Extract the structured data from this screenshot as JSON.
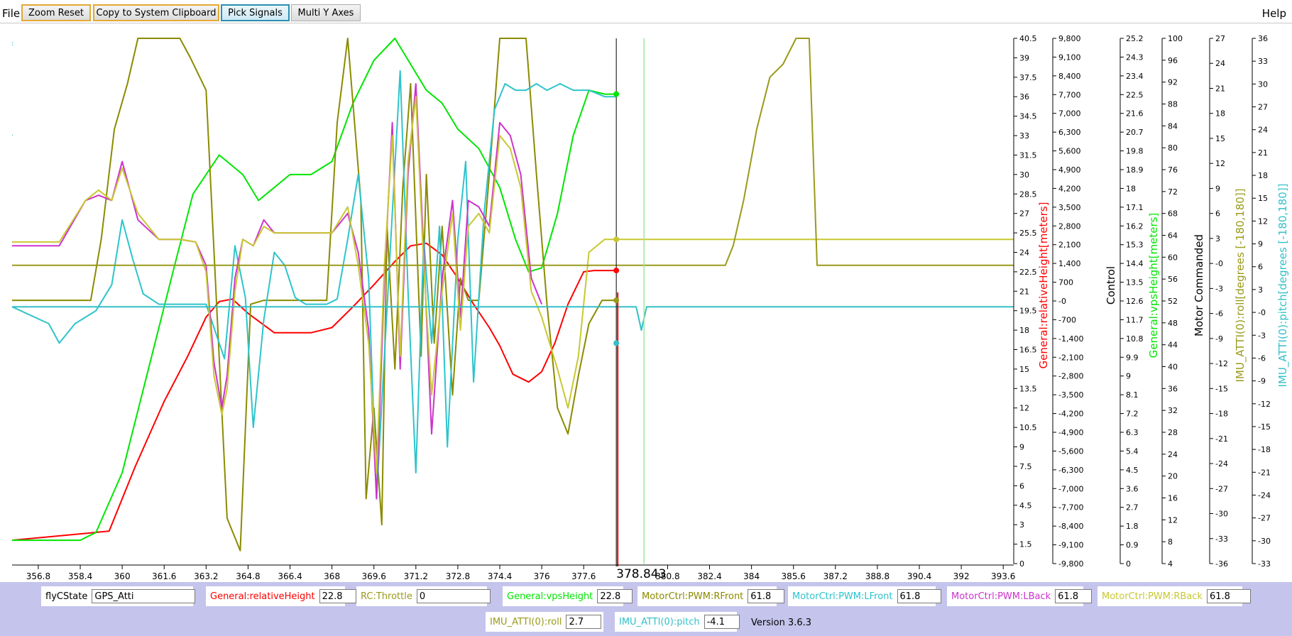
{
  "toolbar": {
    "file_label": "File",
    "zoom_reset_label": "Zoom Reset",
    "copy_clipboard_label": "Copy to System Clipboard",
    "pick_signals_label": "Pick Signals",
    "multi_y_label": "Multi Y Axes",
    "help_label": "Help"
  },
  "colors": {
    "relativeHeight": "#ff0000",
    "vpsHeight": "#00e600",
    "rfront": "#8b8b00",
    "lfront": "#2dc4cc",
    "lback": "#cc33cc",
    "rback": "#c8c832",
    "roll": "#9a9a1a",
    "pitch": "#33c0c8",
    "dark_olive": "#808000",
    "axis": "#000000",
    "panel_bg": "#c4c4ec"
  },
  "chart_data": {
    "type": "line",
    "cursor_label": "378.843",
    "x_ticks": [
      "356.8",
      "358.4",
      "360",
      "361.6",
      "363.2",
      "364.8",
      "366.4",
      "368",
      "369.6",
      "371.2",
      "372.8",
      "374.4",
      "376",
      "377.6",
      "380.8",
      "382.4",
      "384",
      "385.6",
      "387.2",
      "388.8",
      "390.4",
      "392",
      "393.6"
    ],
    "x_tick_values": [
      356.8,
      358.4,
      360,
      361.6,
      363.2,
      364.8,
      366.4,
      368,
      369.6,
      371.2,
      372.8,
      374.4,
      376,
      377.6,
      380.8,
      382.4,
      384,
      385.6,
      387.2,
      388.8,
      390.4,
      392,
      393.6
    ],
    "xlim": [
      355.8,
      394.0
    ],
    "cursor_x": 378.843,
    "x2_ref": 379.9,
    "axes": [
      {
        "id": "axis1",
        "label": "",
        "color": "#000000",
        "ticks": [
          "40.5",
          "39",
          "37.5",
          "36",
          "34.5",
          "33",
          "31.5",
          "30",
          "28.5",
          "27",
          "25.5",
          "24",
          "22.5",
          "21",
          "19.5",
          "18",
          "16.5",
          "15",
          "13.5",
          "12",
          "10.5",
          "9",
          "7.5",
          "6",
          "4.5",
          "3",
          "1.5",
          "0"
        ]
      },
      {
        "id": "relativeHeight",
        "label": "General:relativeHeight[meters]",
        "color": "#ff0000",
        "ticks": [
          "9,800",
          "9,100",
          "8,400",
          "7,700",
          "7,000",
          "6,300",
          "5,600",
          "4,900",
          "4,200",
          "3,500",
          "2,800",
          "2,100",
          "1,400",
          "700",
          "-0",
          "-700",
          "-1,400",
          "-2,100",
          "-2,800",
          "-3,500",
          "-4,200",
          "-4,900",
          "-5,600",
          "-6,300",
          "-7,000",
          "-7,700",
          "-8,400",
          "-9,100",
          "-9,800"
        ]
      },
      {
        "id": "control",
        "label": "Control",
        "color": "#000000",
        "ticks": [
          "25.2",
          "24.3",
          "23.4",
          "22.5",
          "21.6",
          "20.7",
          "19.8",
          "18.9",
          "18",
          "17.1",
          "16.2",
          "15.3",
          "14.4",
          "13.5",
          "12.6",
          "11.7",
          "10.8",
          "9.9",
          "9",
          "8.1",
          "7.2",
          "6.3",
          "5.4",
          "4.5",
          "3.6",
          "2.7",
          "1.8",
          "0.9",
          "0"
        ]
      },
      {
        "id": "vpsHeight",
        "label": "General:vpsHeight[meters]",
        "color": "#00e600",
        "ticks": [
          "100",
          "96",
          "92",
          "88",
          "84",
          "80",
          "76",
          "72",
          "68",
          "64",
          "60",
          "56",
          "52",
          "48",
          "44",
          "40",
          "36",
          "32",
          "28",
          "24",
          "20",
          "16",
          "12",
          "8",
          "4"
        ]
      },
      {
        "id": "motor",
        "label": "Motor Commanded",
        "color": "#000000",
        "ticks": [
          "27",
          "24",
          "21",
          "18",
          "15",
          "12",
          "9",
          "6",
          "3",
          "-0",
          "-3",
          "-6",
          "-9",
          "-12",
          "-15",
          "-18",
          "-21",
          "-24",
          "-27",
          "-30",
          "-33",
          "-36"
        ]
      },
      {
        "id": "roll",
        "label": "IMU_ATTI(0):roll[degrees [-180,180]]",
        "color": "#9a9a1a",
        "ticks": [
          "36",
          "33",
          "30",
          "27",
          "24",
          "21",
          "18",
          "15",
          "12",
          "9",
          "6",
          "3",
          "-0",
          "-3",
          "-6",
          "-9",
          "-12",
          "-15",
          "-18",
          "-21",
          "-24",
          "-27",
          "-30",
          "-33"
        ]
      },
      {
        "id": "pitch",
        "label": "IMU_ATTI(0):pitch[degrees [-180,180]]",
        "color": "#33c0c8",
        "ticks": []
      }
    ],
    "series": [
      {
        "name": "General:relativeHeight",
        "color": "#ff0000",
        "axis_range": [
          0,
          40.5
        ],
        "x": [
          355.8,
          359.5,
          360.5,
          361.6,
          362.5,
          363.2,
          363.7,
          364.2,
          364.8,
          365.8,
          366.4,
          367.2,
          368.0,
          368.8,
          369.6,
          370.4,
          371.0,
          371.6,
          372.2,
          372.8,
          373.4,
          374.0,
          374.4,
          374.9,
          375.5,
          376.0,
          376.5,
          377.0,
          377.6,
          378.0,
          378.843
        ],
        "y": [
          1.8,
          2.5,
          7.5,
          12.5,
          16.0,
          19.0,
          20.2,
          20.4,
          19.3,
          17.8,
          17.8,
          17.8,
          18.2,
          19.8,
          21.5,
          23.3,
          24.5,
          24.7,
          23.8,
          22.0,
          20.0,
          18.2,
          16.8,
          14.6,
          14.0,
          14.8,
          17.0,
          20.0,
          22.5,
          22.6,
          22.6
        ]
      },
      {
        "name": "General:vpsHeight",
        "color": "#00e600",
        "axis_range": [
          0,
          40.5
        ],
        "x": [
          355.8,
          358.4,
          359.0,
          360.0,
          361.0,
          362.0,
          362.7,
          363.7,
          364.6,
          365.2,
          365.8,
          366.4,
          367.2,
          368.0,
          368.8,
          369.6,
          370.4,
          371.0,
          371.6,
          372.2,
          372.8,
          373.6,
          374.4,
          375.0,
          375.5,
          376.0,
          376.6,
          377.2,
          377.8,
          378.4,
          378.843
        ],
        "y": [
          1.8,
          1.8,
          2.4,
          7.0,
          15.0,
          23.0,
          28.5,
          31.5,
          30.0,
          28.0,
          29.0,
          30.0,
          30.0,
          31.0,
          35.5,
          38.8,
          40.5,
          38.5,
          36.5,
          35.5,
          33.5,
          32.0,
          29.0,
          25.0,
          22.5,
          22.8,
          27.0,
          33.0,
          36.5,
          36.2,
          36.2
        ]
      },
      {
        "name": "MotorCtrl:PWM:RFront",
        "color": "#8b8b00",
        "axis_range": [
          0,
          40.5
        ],
        "x": [
          355.8,
          358.8,
          359.2,
          359.7,
          360.2,
          360.6,
          361.2,
          361.6,
          362.2,
          362.6,
          363.2,
          363.6,
          364.0,
          364.5,
          364.9,
          365.4,
          366.0,
          366.6,
          367.2,
          367.8,
          368.2,
          368.6,
          369.1,
          369.3,
          369.6,
          369.9,
          370.1,
          370.4,
          370.7,
          371.0,
          371.4,
          371.6,
          371.9,
          372.2,
          372.6,
          372.9,
          373.2,
          373.6,
          374.0,
          374.4,
          374.7,
          375.0,
          375.4,
          375.8,
          376.2,
          376.6,
          377.0,
          377.4,
          377.8,
          378.3,
          378.843
        ],
        "y": [
          20.3,
          20.3,
          25.0,
          33.5,
          37.0,
          40.5,
          40.5,
          40.5,
          40.5,
          39.0,
          36.5,
          20.0,
          3.5,
          1.0,
          20.0,
          20.3,
          20.3,
          20.3,
          20.3,
          20.3,
          34.0,
          40.5,
          28.0,
          5.0,
          12.0,
          3.0,
          26.0,
          15.0,
          29.0,
          37.0,
          16.0,
          30.0,
          17.0,
          26.0,
          13.0,
          22.0,
          20.3,
          20.3,
          30.0,
          40.5,
          40.5,
          40.5,
          40.5,
          30.0,
          20.0,
          12.0,
          10.0,
          14.5,
          18.5,
          20.3,
          20.3
        ]
      },
      {
        "name": "MotorCtrl:PWM:LFront",
        "color": "#2dc4cc",
        "axis_range": [
          0,
          40.5
        ],
        "x": [
          355.8,
          357.2,
          357.6,
          358.2,
          359.0,
          359.6,
          360.0,
          360.4,
          360.8,
          361.4,
          362.0,
          362.8,
          363.2,
          363.5,
          363.9,
          364.3,
          364.7,
          365.0,
          365.4,
          365.8,
          366.2,
          366.6,
          367.0,
          367.4,
          367.8,
          368.2,
          368.6,
          369.0,
          369.4,
          369.7,
          370.0,
          370.3,
          370.6,
          370.9,
          371.2,
          371.5,
          371.8,
          372.1,
          372.4,
          372.8,
          373.1,
          373.4,
          373.8,
          374.2,
          374.6,
          375.0,
          375.4,
          375.8,
          376.2,
          376.7,
          377.2,
          377.8,
          378.4,
          378.843
        ],
        "y": [
          19.8,
          18.5,
          17.0,
          18.5,
          19.5,
          21.5,
          26.5,
          23.5,
          20.8,
          20.0,
          20.0,
          20.0,
          20.0,
          18.2,
          15.8,
          24.5,
          20.5,
          10.5,
          18.8,
          24.0,
          23.0,
          20.5,
          20.0,
          20.0,
          20.0,
          20.4,
          25.0,
          30.0,
          22.0,
          5.0,
          16.0,
          27.0,
          38.0,
          21.0,
          7.0,
          25.0,
          17.0,
          26.0,
          9.0,
          25.0,
          31.0,
          14.0,
          27.0,
          35.0,
          37.0,
          36.5,
          36.5,
          37.0,
          36.5,
          37.0,
          36.5,
          36.5,
          36.0,
          36.0
        ]
      },
      {
        "name": "MotorCtrl:PWM:LBack",
        "color": "#cc33cc",
        "axis_range": [
          0,
          40.5
        ],
        "x": [
          355.8,
          357.6,
          358.6,
          359.1,
          359.6,
          360.0,
          360.6,
          361.4,
          362.2,
          362.8,
          363.2,
          363.5,
          363.8,
          364.0,
          364.3,
          364.6,
          365.0,
          365.4,
          365.8,
          366.2,
          366.8,
          367.4,
          368.0,
          368.6,
          369.0,
          369.4,
          369.7,
          370.0,
          370.3,
          370.6,
          370.9,
          371.2,
          371.5,
          371.8,
          372.2,
          372.6,
          372.9,
          373.2,
          373.6,
          374.0,
          374.4,
          374.8,
          375.2,
          375.6,
          376.0
        ],
        "y": [
          24.5,
          24.5,
          28.0,
          28.4,
          28.0,
          31.0,
          26.5,
          25.0,
          25.0,
          24.8,
          23.0,
          15.5,
          12.0,
          14.5,
          22.0,
          25.0,
          24.5,
          26.5,
          25.5,
          25.5,
          25.5,
          25.5,
          25.5,
          27.0,
          24.0,
          18.0,
          5.0,
          22.0,
          34.0,
          15.0,
          30.0,
          37.0,
          24.0,
          10.0,
          22.0,
          28.0,
          19.0,
          28.0,
          27.5,
          26.0,
          34.0,
          33.0,
          30.0,
          22.0,
          20.0
        ]
      },
      {
        "name": "MotorCtrl:PWM:RBack",
        "color": "#c8c832",
        "axis_range": [
          0,
          40.5
        ],
        "x": [
          355.8,
          357.6,
          358.6,
          359.1,
          359.6,
          360.0,
          360.6,
          361.4,
          362.2,
          362.8,
          363.2,
          363.5,
          363.8,
          364.0,
          364.3,
          364.6,
          365.0,
          365.4,
          365.8,
          366.2,
          366.8,
          367.4,
          368.0,
          368.6,
          369.0,
          369.4,
          369.7,
          370.0,
          370.3,
          370.6,
          370.9,
          371.2,
          371.5,
          371.8,
          372.2,
          372.6,
          372.9,
          373.2,
          373.6,
          374.0,
          374.4,
          374.8,
          375.2,
          375.6,
          376.0,
          376.6,
          377.0,
          377.4,
          377.8,
          378.4,
          378.843,
          379.5,
          394.0
        ],
        "y": [
          24.8,
          24.8,
          28.0,
          28.8,
          28.0,
          30.5,
          27.0,
          25.0,
          25.0,
          24.8,
          22.5,
          14.5,
          11.5,
          13.5,
          21.0,
          25.0,
          24.5,
          26.0,
          25.5,
          25.5,
          25.5,
          25.5,
          25.5,
          27.5,
          23.0,
          17.0,
          7.0,
          23.0,
          33.0,
          16.0,
          31.0,
          36.0,
          23.0,
          13.0,
          21.0,
          27.0,
          18.0,
          26.0,
          27.0,
          25.5,
          33.0,
          32.0,
          29.0,
          21.0,
          19.0,
          15.0,
          12.0,
          16.0,
          24.0,
          25.0,
          25.0,
          25.0,
          25.0
        ]
      },
      {
        "name": "IMU_ATTI(0):roll",
        "color": "#9a9a1a",
        "axis_range": [
          0,
          40.5
        ],
        "x": [
          355.8,
          360.0,
          364.0,
          368.0,
          372.0,
          376.0,
          378.843,
          382.0,
          383.0,
          383.3,
          383.7,
          384.2,
          384.7,
          385.2,
          385.7,
          386.2,
          386.5,
          387.0,
          388.0,
          394.0
        ],
        "y": [
          23.0,
          23.0,
          23.0,
          23.0,
          23.0,
          23.0,
          23.0,
          23.0,
          23.0,
          24.5,
          28.0,
          33.5,
          37.5,
          38.5,
          40.5,
          40.5,
          23.0,
          23.0,
          23.0,
          23.0
        ]
      },
      {
        "name": "IMU_ATTI(0):pitch",
        "color": "#33c0c8",
        "axis_range": [
          0,
          40.5
        ],
        "x": [
          355.8,
          378.0,
          378.843,
          379.6,
          379.8,
          380.0,
          394.0
        ],
        "y": [
          19.8,
          19.8,
          19.8,
          19.8,
          18.0,
          19.8,
          19.8
        ]
      }
    ]
  },
  "signals": [
    {
      "label": "flyCState",
      "value": "GPS_Atti",
      "color": "#000000"
    },
    {
      "label": "General:relativeHeight",
      "value": "22.8",
      "color": "#ff0000"
    },
    {
      "label": "RC:Throttle",
      "value": "0",
      "color": "#9a9a1a"
    },
    {
      "label": "General:vpsHeight",
      "value": "22.8",
      "color": "#00e600"
    },
    {
      "label": "MotorCtrl:PWM:RFront",
      "value": "61.8",
      "color": "#8b8b00"
    },
    {
      "label": "MotorCtrl:PWM:LFront",
      "value": "61.8",
      "color": "#2dc4cc"
    },
    {
      "label": "MotorCtrl:PWM:LBack",
      "value": "61.8",
      "color": "#cc33cc"
    },
    {
      "label": "MotorCtrl:PWM:RBack",
      "value": "61.8",
      "color": "#c8c832"
    },
    {
      "label": "IMU_ATTI(0):roll",
      "value": "2.7",
      "color": "#9a9a1a"
    },
    {
      "label": "IMU_ATTI(0):pitch",
      "value": "-4.1",
      "color": "#33c0c8"
    }
  ],
  "version_text": "Version 3.6.3"
}
